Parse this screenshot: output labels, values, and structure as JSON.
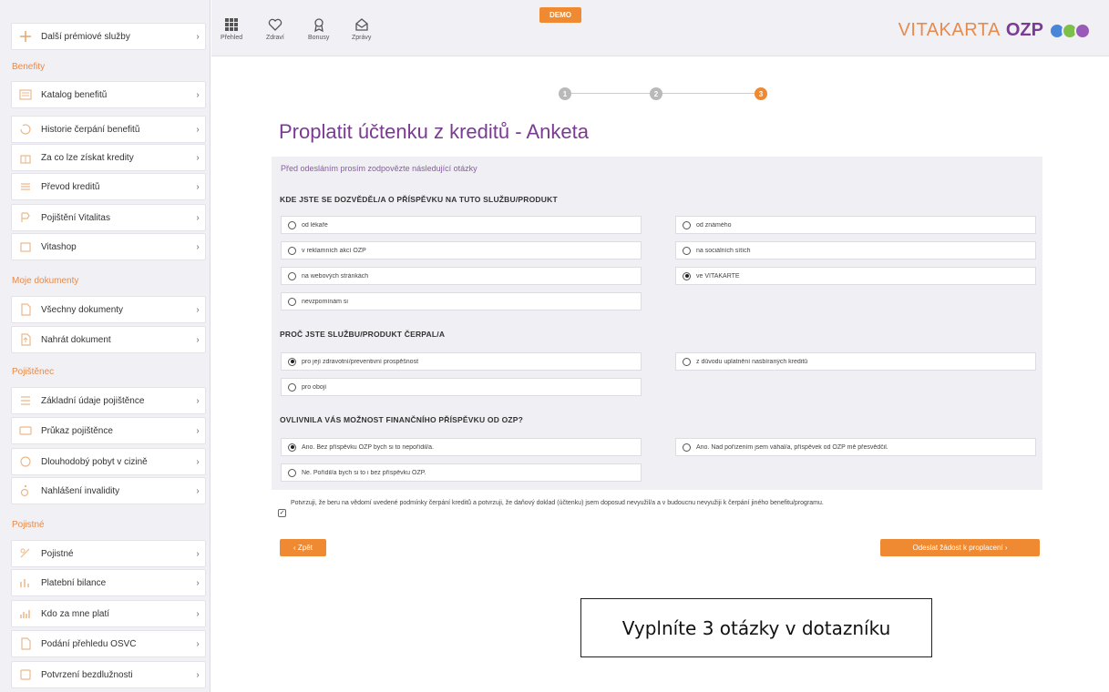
{
  "sidebar": {
    "items": [
      {
        "label": "Další prémiové služby",
        "icon": "plus-icon",
        "chevron": "›"
      },
      {
        "label": "Katalog benefitů",
        "icon": "catalog-icon",
        "chevron": "›"
      },
      {
        "label": "Historie čerpání benefitů",
        "icon": "history-icon",
        "chevron": "›"
      },
      {
        "label": "Za co lze získat kredity",
        "icon": "gift-icon",
        "chevron": "›"
      },
      {
        "label": "Převod kreditů",
        "icon": "transfer-icon",
        "chevron": "›"
      },
      {
        "label": "Pojištění Vitalitas",
        "icon": "insurance-icon",
        "chevron": "›"
      },
      {
        "label": "Vitashop",
        "icon": "shop-icon",
        "chevron": "›"
      },
      {
        "label": "Všechny dokumenty",
        "icon": "documents-icon",
        "chevron": "›"
      },
      {
        "label": "Nahrát dokument",
        "icon": "upload-icon",
        "chevron": "›"
      },
      {
        "label": "Základní údaje pojištěnce",
        "icon": "person-card-icon",
        "chevron": "›"
      },
      {
        "label": "Průkaz pojištěnce",
        "icon": "id-card-icon",
        "chevron": "›"
      },
      {
        "label": "Dlouhodobý pobyt v cizině",
        "icon": "globe-icon",
        "chevron": "›"
      },
      {
        "label": "Nahlášení invalidity",
        "icon": "wheelchair-icon",
        "chevron": "›"
      },
      {
        "label": "Pojistné",
        "icon": "wallet-icon",
        "chevron": "›"
      },
      {
        "label": "Platební bilance",
        "icon": "balance-icon",
        "chevron": "›"
      },
      {
        "label": "Kdo za mne platí",
        "icon": "payer-icon",
        "chevron": "›"
      },
      {
        "label": "Podání přehledu OSVČ",
        "icon": "report-icon",
        "chevron": "›"
      },
      {
        "label": "Potvrzení bezdlužnosti",
        "icon": "certificate-icon",
        "chevron": "›"
      }
    ],
    "sections": {
      "benefity": "Benefity",
      "dokumenty": "Moje dokumenty",
      "pojistenec": "Pojištěnec",
      "pojistne": "Pojistné"
    }
  },
  "topnav": {
    "items": [
      {
        "label": "Přehled",
        "icon": "grid-icon"
      },
      {
        "label": "Zdraví",
        "icon": "heart-icon"
      },
      {
        "label": "Bonusy",
        "icon": "award-icon"
      },
      {
        "label": "Zprávy",
        "icon": "mail-icon"
      }
    ],
    "demo": "DEMO"
  },
  "brand": {
    "vita": "VITAKARTA",
    "ozp": "OZP",
    "colors": {
      "blue": "#4a86d8",
      "green": "#7cc04a",
      "purple": "#9a5bb8",
      "orange": "#e58b4d"
    }
  },
  "stepper": {
    "steps": [
      "1",
      "2",
      "3"
    ],
    "active": 3,
    "colors": {
      "done": "#b9b9b9",
      "active": "#f08a32"
    }
  },
  "page": {
    "title": "Proplatit účtenku z kreditů - Anketa",
    "intro": "Před odesláním prosím zodpovězte následující otázky"
  },
  "questions": [
    {
      "heading": "KDE JSTE SE DOZVĚDĚL/A O PŘÍSPĚVKU NA TUTO SLUŽBU/PRODUKT",
      "options": [
        {
          "label": "od lékaře",
          "selected": false
        },
        {
          "label": "od známého",
          "selected": false
        },
        {
          "label": "v reklamních akcí OZP",
          "selected": false
        },
        {
          "label": "na sociálních sítích",
          "selected": false
        },
        {
          "label": "na webových stránkách",
          "selected": false
        },
        {
          "label": "ve VITAKARTĚ",
          "selected": true
        },
        {
          "label": "nevzpomínám si",
          "selected": false
        }
      ]
    },
    {
      "heading": "PROČ JSTE SLUŽBU/PRODUKT ČERPAL/A",
      "options": [
        {
          "label": "pro její zdravotní/preventivní prospěšnost",
          "selected": true
        },
        {
          "label": "z důvodu uplatnění nasbíraných kreditů",
          "selected": false
        },
        {
          "label": "pro obojí",
          "selected": false
        }
      ]
    },
    {
      "heading": "OVLIVNILA VÁS MOŽNOST FINANČNÍHO PŘÍSPĚVKU OD OZP?",
      "options": [
        {
          "label": "Ano. Bez příspěvku OZP bych si to nepořídil/a.",
          "selected": true
        },
        {
          "label": "Ano. Nad pořízením jsem váhal/a, příspěvek od OZP mě přesvědčil.",
          "selected": false
        },
        {
          "label": "Ne. Pořídil/a bych si to i bez příspěvku OZP.",
          "selected": false
        }
      ]
    }
  ],
  "consent": {
    "checked": true,
    "text": "Potvrzuji, že beru na vědomí uvedené podmínky čerpání kreditů a potvrzuji, že daňový doklad (účtenku) jsem doposud nevyužil/a a v budoucnu nevyužiji k čerpání jiného benefitu/programu."
  },
  "buttons": {
    "back": "‹ Zpět",
    "submit": "Odeslat žádost k proplacení ›"
  },
  "callout": "Vyplníte 3 otázky v dotazníku"
}
